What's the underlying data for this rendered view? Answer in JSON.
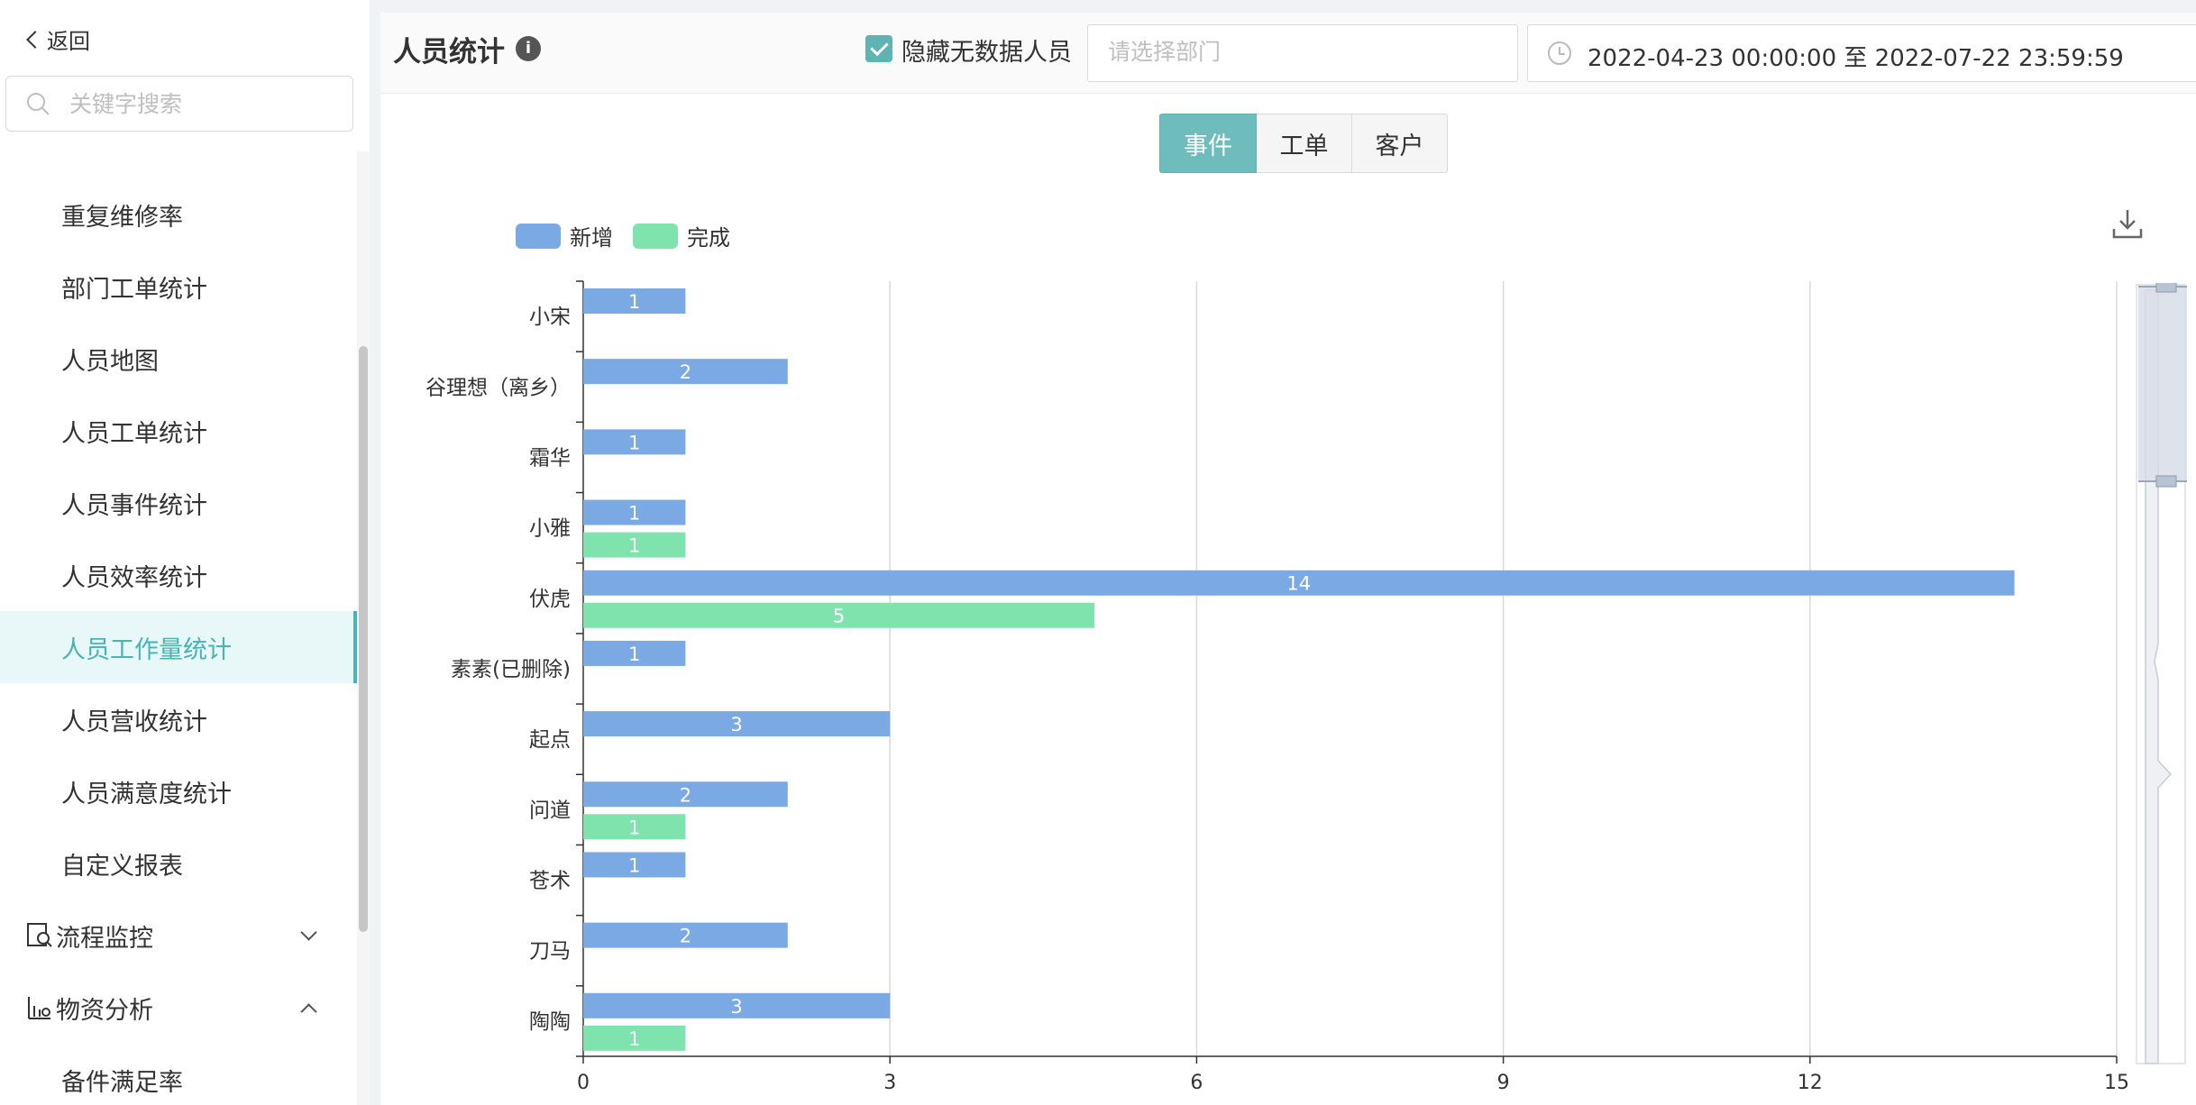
{
  "sidebar": {
    "back_label": "返回",
    "search_placeholder": "关键字搜索",
    "items": [
      {
        "label": "重复维修率"
      },
      {
        "label": "部门工单统计"
      },
      {
        "label": "人员地图"
      },
      {
        "label": "人员工单统计"
      },
      {
        "label": "人员事件统计"
      },
      {
        "label": "人员效率统计"
      },
      {
        "label": "人员工作量统计",
        "active": true
      },
      {
        "label": "人员营收统计"
      },
      {
        "label": "人员满意度统计"
      },
      {
        "label": "自定义报表"
      }
    ],
    "groups": [
      {
        "label": "流程监控",
        "icon": "process-monitor-icon",
        "expanded": false
      },
      {
        "label": "物资分析",
        "icon": "material-analysis-icon",
        "expanded": true
      }
    ],
    "subitems": [
      {
        "label": "备件满足率"
      }
    ]
  },
  "header": {
    "title": "人员统计",
    "hide_no_data_label": "隐藏无数据人员",
    "hide_no_data_checked": true,
    "dept_placeholder": "请选择部门",
    "date_range": "2022-04-23 00:00:00  至 2022-07-22 23:59:59"
  },
  "tabs": [
    {
      "label": "事件",
      "active": true
    },
    {
      "label": "工单",
      "active": false
    },
    {
      "label": "客户",
      "active": false
    }
  ],
  "colors": {
    "accent": "#5fb3b3",
    "series_new": "#7aa9e3",
    "series_done": "#7fe3ad"
  },
  "chart_data": {
    "type": "bar",
    "orientation": "horizontal",
    "categories": [
      "小宋",
      "谷理想（离乡）",
      "霜华",
      "小雅",
      "伏虎",
      "素素(已删除)",
      "起点",
      "问道",
      "苍术",
      "刀马",
      "陶陶"
    ],
    "series": [
      {
        "name": "新增",
        "values": [
          1,
          2,
          1,
          1,
          14,
          1,
          3,
          2,
          1,
          2,
          3
        ]
      },
      {
        "name": "完成",
        "values": [
          0,
          0,
          0,
          1,
          5,
          0,
          0,
          1,
          0,
          0,
          1
        ]
      }
    ],
    "xlim": [
      0,
      15
    ],
    "xticks": [
      0,
      3,
      6,
      9,
      12,
      15
    ],
    "grid": true,
    "legend": "top-left"
  }
}
